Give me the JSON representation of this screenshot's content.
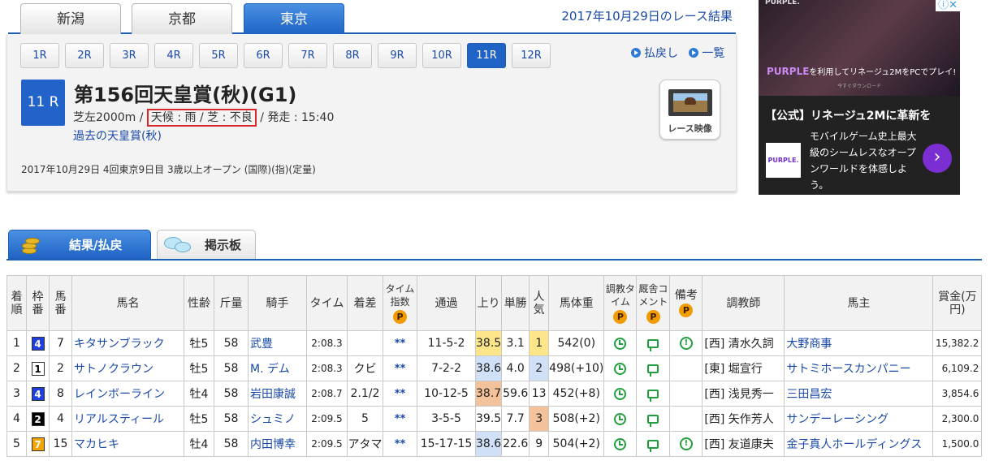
{
  "venue_tabs": [
    "新潟",
    "京都",
    "東京"
  ],
  "active_venue": "東京",
  "date_title": "2017年10月29日のレース結果",
  "race_buttons": [
    "1R",
    "2R",
    "3R",
    "4R",
    "5R",
    "6R",
    "7R",
    "8R",
    "9R",
    "10R",
    "11R",
    "12R"
  ],
  "active_race": "11R",
  "links": {
    "refund": "払戻し",
    "list": "一覧"
  },
  "race": {
    "badge": "11 R",
    "title": "第156回天皇賞(秋)(G1)",
    "course": "芝左2000m",
    "sep": " / ",
    "weather": "天候 : 雨 / 芝 : 不良",
    "start": "発走 : 15:40",
    "past_link": "過去の天皇賞(秋)",
    "details": "2017年10月29日 4回東京9日目 3歳以上オープン (国際)(指)(定量)",
    "video_label": "レース映像"
  },
  "ad": {
    "brand": "PURPLE.",
    "line1_brand": "PURPLE",
    "line1_rest": "を利用してリネージュ2MをPCでプレイ!",
    "sub": "今すぐダウンロード",
    "headline": "【公式】リネージュ2Mに革新を",
    "body": "モバイルゲーム史上最大級のシームレスなオープンワールドを体感しよう。",
    "logo2": "PURPLE.",
    "arrow": "›",
    "close": "ⓘ✕"
  },
  "content_tabs": {
    "results": "結果/払戻",
    "board": "掲示板"
  },
  "p_badge": "P",
  "headers": {
    "rank": "着順",
    "frame": "枠番",
    "num": "馬番",
    "horse": "馬名",
    "sexage": "性齢",
    "weight": "斤量",
    "jockey": "騎手",
    "time": "タイム",
    "margin": "着差",
    "tindex": "タイム指数",
    "passing": "通過",
    "last3f": "上り",
    "odds": "単勝",
    "pop": "人気",
    "bodyweight": "馬体重",
    "train_time": "調教タイム",
    "stable_comment": "厩舎コメント",
    "note": "備考",
    "trainer": "調教師",
    "owner": "馬主",
    "prize": "賞金(万円)"
  },
  "rows": [
    {
      "rank": "1",
      "frame": "4",
      "num": "7",
      "horse": "キタサンブラック",
      "sexage": "牡5",
      "weight": "58",
      "jockey": "武豊",
      "time": "2:08.3",
      "margin": "",
      "tindex": "**",
      "passing": "11-5-2",
      "last3f": "38.5",
      "odds": "3.1",
      "pop": "1",
      "bodyweight": "542(0)",
      "note": true,
      "trainer": "[西] 清水久詞",
      "owner": "大野商事",
      "prize": "15,382.2"
    },
    {
      "rank": "2",
      "frame": "1",
      "num": "2",
      "horse": "サトノクラウン",
      "sexage": "牡5",
      "weight": "58",
      "jockey": "M. デム",
      "time": "2:08.3",
      "margin": "クビ",
      "tindex": "**",
      "passing": "7-2-2",
      "last3f": "38.6",
      "odds": "4.0",
      "pop": "2",
      "bodyweight": "498(+10)",
      "note": false,
      "trainer": "[東] 堀宣行",
      "owner": "サトミホースカンパニー",
      "prize": "6,109.2"
    },
    {
      "rank": "3",
      "frame": "4",
      "num": "8",
      "horse": "レインボーライン",
      "sexage": "牡4",
      "weight": "58",
      "jockey": "岩田康誠",
      "time": "2:08.7",
      "margin": "2.1/2",
      "tindex": "**",
      "passing": "10-12-5",
      "last3f": "38.7",
      "odds": "59.6",
      "pop": "13",
      "bodyweight": "452(+8)",
      "note": false,
      "trainer": "[西] 浅見秀一",
      "owner": "三田昌宏",
      "prize": "3,854.6"
    },
    {
      "rank": "4",
      "frame": "2",
      "num": "4",
      "horse": "リアルスティール",
      "sexage": "牡5",
      "weight": "58",
      "jockey": "シュミノ",
      "time": "2:09.5",
      "margin": "5",
      "tindex": "**",
      "passing": "3-5-5",
      "last3f": "39.5",
      "odds": "7.7",
      "pop": "3",
      "bodyweight": "508(+2)",
      "note": false,
      "trainer": "[西] 矢作芳人",
      "owner": "サンデーレーシング",
      "prize": "2,300.0"
    },
    {
      "rank": "5",
      "frame": "7",
      "num": "15",
      "horse": "マカヒキ",
      "sexage": "牡4",
      "weight": "58",
      "jockey": "内田博幸",
      "time": "2:09.5",
      "margin": "アタマ",
      "tindex": "**",
      "passing": "15-17-15",
      "last3f": "38.6",
      "odds": "22.6",
      "pop": "9",
      "bodyweight": "504(+2)",
      "note": true,
      "trainer": "[西] 友道康夫",
      "owner": "金子真人ホールディングス",
      "prize": "1,500.0"
    }
  ],
  "colors": {
    "accent": "#1f63c6",
    "frame1": "#ffffff",
    "frame2": "#000000",
    "frame4": "#1f3fe0",
    "frame7": "#f5a300",
    "up_rank1": "#fde68a",
    "up_rank2": "#cfe0f7",
    "up_rank3": "#f3c29a",
    "icon_green": "#22a040"
  }
}
